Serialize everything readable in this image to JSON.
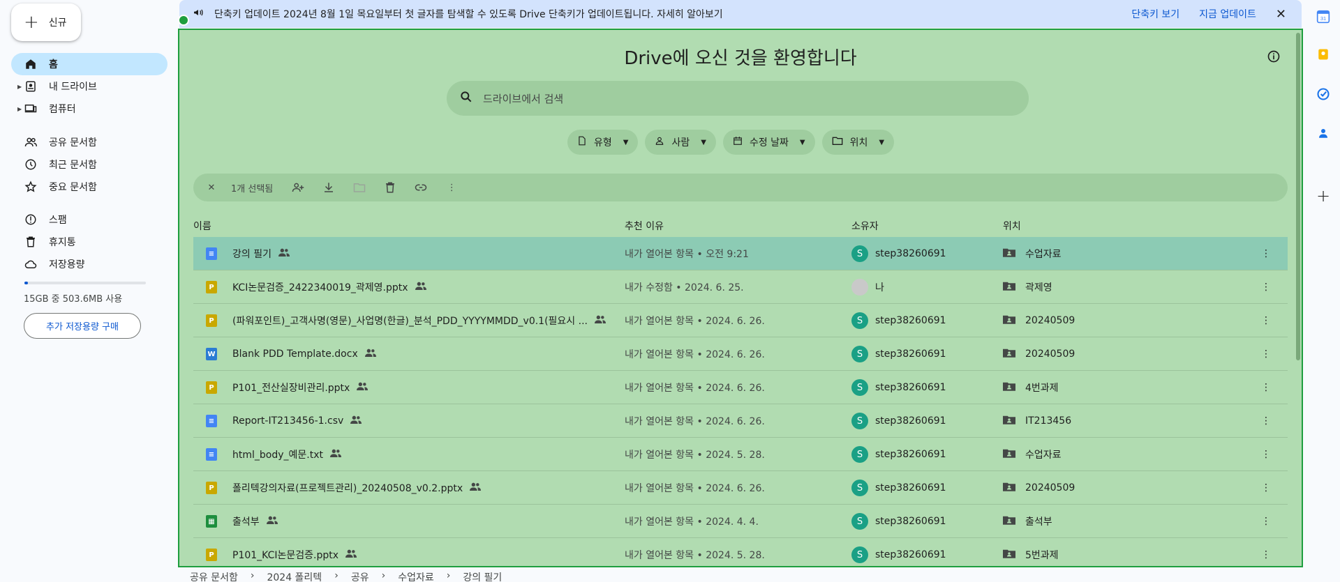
{
  "sidebar": {
    "new_label": "신규",
    "items": [
      {
        "label": "홈",
        "icon": "home-icon"
      },
      {
        "label": "내 드라이브",
        "icon": "my-drive-icon"
      },
      {
        "label": "컴퓨터",
        "icon": "computer-icon"
      },
      {
        "label": "공유 문서함",
        "icon": "shared-icon"
      },
      {
        "label": "최근 문서함",
        "icon": "clock-icon"
      },
      {
        "label": "중요 문서함",
        "icon": "star-icon"
      },
      {
        "label": "스팸",
        "icon": "spam-icon"
      },
      {
        "label": "휴지통",
        "icon": "trash-icon"
      },
      {
        "label": "저장용량",
        "icon": "cloud-icon"
      }
    ],
    "storage_used_fraction": 0.03,
    "storage_text": "15GB 중 503.6MB 사용",
    "buy_label": "추가 저장용량 구매"
  },
  "banner": {
    "message": "단축키 업데이트 2024년 8월 1일 목요일부터 첫 글자를 탐색할 수 있도록 Drive 단축키가 업데이트됩니다. 자세히 알아보기",
    "view_label": "단축키 보기",
    "update_label": "지금 업데이트"
  },
  "main": {
    "welcome": "Drive에 오신 것을 환영합니다",
    "search_placeholder": "드라이브에서 검색",
    "chips": [
      "유형",
      "사람",
      "수정 날짜",
      "위치"
    ],
    "selection_count": "1개 선택됨",
    "columns": {
      "name": "이름",
      "reason": "추천 이유",
      "owner": "소유자",
      "location": "위치"
    }
  },
  "files": [
    {
      "name": "강의 필기",
      "type": "doc",
      "reason": "내가 열어본 항목 • 오전 9:21",
      "owner": "step38260691",
      "location": "수업자료",
      "selected": true
    },
    {
      "name": "KCI논문검증_2422340019_곽제영.pptx",
      "type": "ppt",
      "reason": "내가 수정함 • 2024. 6. 25.",
      "owner": "나",
      "location": "곽제영",
      "me": true
    },
    {
      "name": "(파워포인트)_고객사명(영문)_사업명(한글)_분석_PDD_YYYYMMDD_v0.1(필요시 ...",
      "type": "ppt",
      "reason": "내가 열어본 항목 • 2024. 6. 26.",
      "owner": "step38260691",
      "location": "20240509"
    },
    {
      "name": "Blank PDD Template.docx",
      "type": "word",
      "reason": "내가 열어본 항목 • 2024. 6. 26.",
      "owner": "step38260691",
      "location": "20240509"
    },
    {
      "name": "P101_전산실장비관리.pptx",
      "type": "ppt",
      "reason": "내가 열어본 항목 • 2024. 6. 26.",
      "owner": "step38260691",
      "location": "4번과제"
    },
    {
      "name": "Report-IT213456-1.csv",
      "type": "text",
      "reason": "내가 열어본 항목 • 2024. 6. 26.",
      "owner": "step38260691",
      "location": "IT213456"
    },
    {
      "name": "html_body_예문.txt",
      "type": "text",
      "reason": "내가 열어본 항목 • 2024. 5. 28.",
      "owner": "step38260691",
      "location": "수업자료"
    },
    {
      "name": "폴리텍강의자료(프로젝트관리)_20240508_v0.2.pptx",
      "type": "ppt",
      "reason": "내가 열어본 항목 • 2024. 6. 26.",
      "owner": "step38260691",
      "location": "20240509"
    },
    {
      "name": "출석부",
      "type": "sheet",
      "reason": "내가 열어본 항목 • 2024. 4. 4.",
      "owner": "step38260691",
      "location": "출석부"
    },
    {
      "name": "P101_KCI논문검증.pptx",
      "type": "ppt",
      "reason": "내가 열어본 항목 • 2024. 5. 28.",
      "owner": "step38260691",
      "location": "5번과제"
    }
  ],
  "breadcrumbs": [
    "공유 문서함",
    "2024 폴리텍",
    "공유",
    "수업자료",
    "강의 필기"
  ],
  "colors": {
    "accent": "#0b57d0",
    "panel": "#b1dcb1",
    "selected_row": "#8ccbb4",
    "banner": "#d3e3fd"
  }
}
